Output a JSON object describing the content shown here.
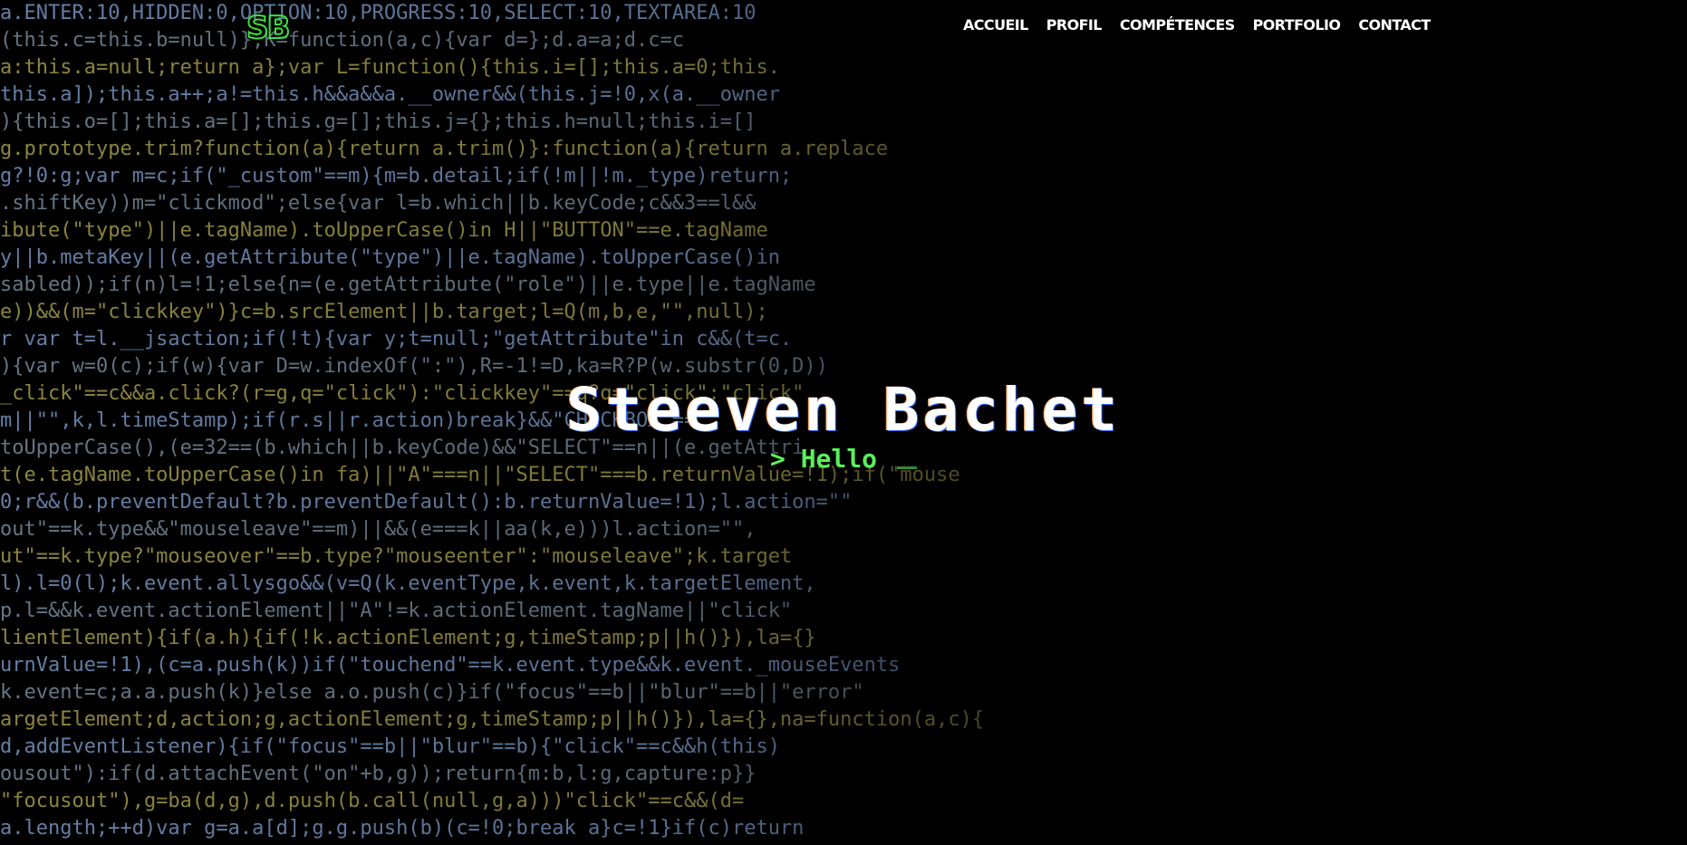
{
  "brand": {
    "logo": "SB",
    "accent": "#3de03d"
  },
  "nav": {
    "items": [
      {
        "label": "ACCUEIL"
      },
      {
        "label": "PROFIL"
      },
      {
        "label": "COMPÉTENCES"
      },
      {
        "label": "PORTFOLIO"
      },
      {
        "label": "CONTACT"
      }
    ]
  },
  "hero": {
    "title": "Steeven Bachet",
    "prompt": ">",
    "typed": "Hello"
  },
  "background_code": [
    "a.ENTER:10,HIDDEN:0,OPTION:10,PROGRESS:10,SELECT:10,TEXTAREA:10",
    "(this.c=this.b=null)},K=function(a,c){var d=};d.a=a;d.c=c",
    "a:this.a=null;return a};var L=function(){this.i=[];this.a=0;this.",
    "this.a]);this.a++;a!=this.h&&a&&a.__owner&&(this.j=!0,x(a.__owner",
    "){this.o=[];this.a=[];this.g=[];this.j={};this.h=null;this.i=[]",
    "g.prototype.trim?function(a){return a.trim()}:function(a){return a.replace",
    "g?!0:g;var m=c;if(\"_custom\"==m){m=b.detail;if(!m||!m._type)return;",
    ".shiftKey))m=\"clickmod\";else{var l=b.which||b.keyCode;c&&3==l&&",
    "ibute(\"type\")||e.tagName).toUpperCase()in H||\"BUTTON\"==e.tagName",
    "y||b.metaKey||(e.getAttribute(\"type\")||e.tagName).toUpperCase()in",
    "sabled));if(n)l=!1;else{n=(e.getAttribute(\"role\")||e.type||e.tagName",
    "e))&&(m=\"clickkey\")}c=b.srcElement||b.target;l=Q(m,b,e,\"\",null);",
    "r var t=l.__jsaction;if(!t){var y;t=null;\"getAttribute\"in c&&(t=c.",
    "){var w=0(c);if(w){var D=w.indexOf(\":\"),R=-1!=D,ka=R?P(w.substr(0,D))",
    "_click\"==c&&a.click?(r=g,q=\"click\"):\"clickkey\"==q?q=\"click\":\"click\"",
    "m||\"\",k,l.timeStamp);if(r.s||r.action)break}&&\"CHECKBOX\"==",
    "toUpperCase(),(e=32==(b.which||b.keyCode)&&\"SELECT\"==n||(e.getAttri",
    "t(e.tagName.toUpperCase()in fa)||\"A\"===n||\"SELECT\"===b.returnValue=!1);if(\"mouse",
    "0;r&&(b.preventDefault?b.preventDefault():b.returnValue=!1);l.action=\"\"",
    "out\"==k.type&&\"mouseleave\"==m)||&&(e===k||aa(k,e)))l.action=\"\",",
    "ut\"==k.type?\"mouseover\"==b.type?\"mouseenter\":\"mouseleave\";k.target",
    "l).l=0(l);k.event.allysgo&&(v=Q(k.eventType,k.event,k.targetElement,",
    "p.l=&&k.event.actionElement||\"A\"!=k.actionElement.tagName||\"click\"",
    "lientElement){if(a.h){if(!k.actionElement;g,timeStamp;p||h()}),la={}",
    "urnValue=!1),(c=a.push(k))if(\"touchend\"==k.event.type&&k.event._mouseEvents",
    "k.event=c;a.a.push(k)}else a.o.push(c)}if(\"focus\"==b||\"blur\"==b||\"error\"",
    "argetElement;d,action;g,actionElement;g,timeStamp;p||h()}),la={},na=function(a,c){",
    "d,addEventListener){if(\"focus\"==b||\"blur\"==b){\"click\"==c&&h(this)",
    "ousout\"):if(d.attachEvent(\"on\"+b,g));return{m:b,l:g,capture:p}}",
    "\"focusout\"),g=ba(d,g),d.push(b.call(null,g,a)))\"click\"==c&&(d=",
    "a.length;++d)var g=a.a[d];g.g.push(b)(c=!0;break a}c=!1}if(c)return"
  ]
}
